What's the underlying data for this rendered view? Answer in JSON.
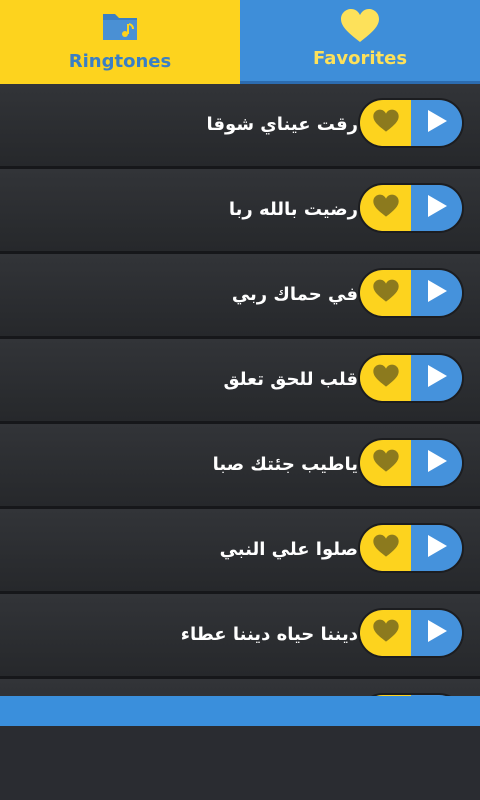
{
  "tabs": {
    "ringtones": {
      "label": "Ringtones",
      "icon": "folder-music-icon",
      "selected": true
    },
    "favorites": {
      "label": "Favorites",
      "icon": "heart-icon",
      "selected": false
    }
  },
  "colors": {
    "yellow": "#fdd31e",
    "blue": "#3e8ed9",
    "row_bg": "#2e3034",
    "heart": "#8c7a1e"
  },
  "ringtones": [
    {
      "title": "رقت عيناي شوقا"
    },
    {
      "title": "رضيت بالله ربا"
    },
    {
      "title": "في حماك ربي"
    },
    {
      "title": "قلب للحق تعلق"
    },
    {
      "title": "ياطيب جئتك صبا"
    },
    {
      "title": "صلوا علي النبي"
    },
    {
      "title": "ديننا حياه ديننا عطاء"
    },
    {
      "title": ""
    }
  ]
}
